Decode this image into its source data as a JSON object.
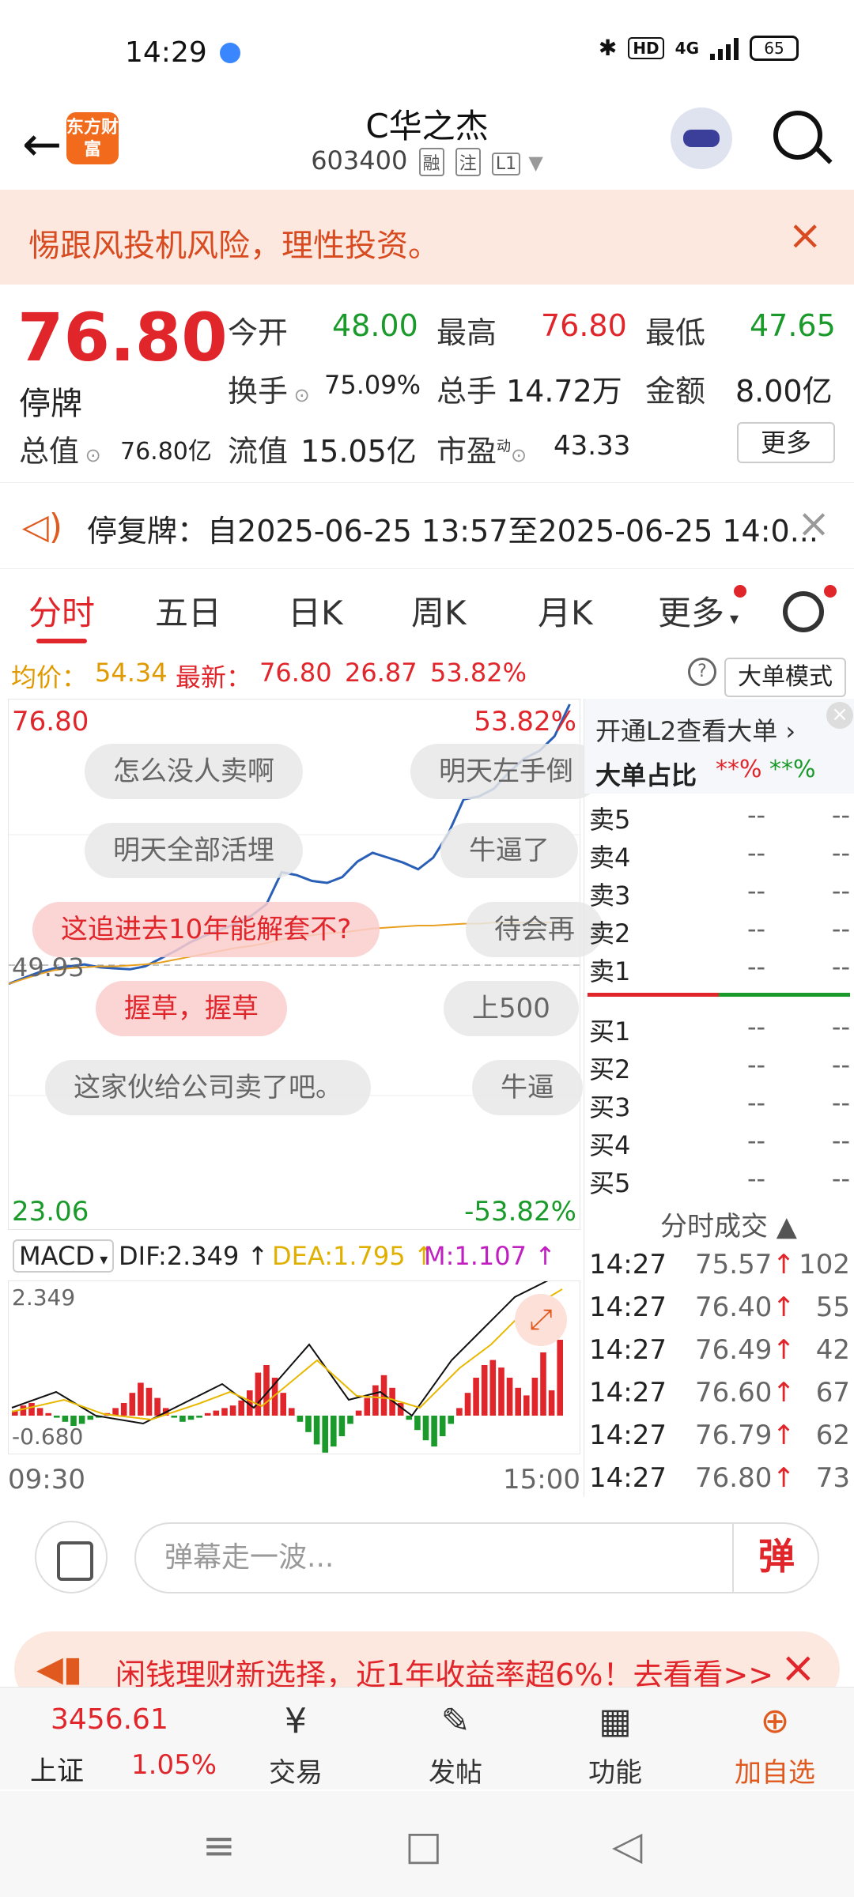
{
  "status_bar": {
    "time": "14:29",
    "network": "4G",
    "battery": "65"
  },
  "header": {
    "back_icon": "←",
    "logo_text": "东方财富",
    "title": "C华之杰",
    "code": "603400",
    "tags": [
      "融",
      "注",
      "L1"
    ]
  },
  "warning": {
    "text": "惕跟风投机风险，理性投资。",
    "close": "×"
  },
  "quote": {
    "price": "76.80",
    "status": "停牌",
    "fields": [
      {
        "label": "今开",
        "value": "48.00",
        "color": "green"
      },
      {
        "label": "最高",
        "value": "76.80",
        "color": "red"
      },
      {
        "label": "最低",
        "value": "47.65",
        "color": "green"
      },
      {
        "label": "换手",
        "value": "75.09%",
        "color": "plain"
      },
      {
        "label": "总手",
        "value": "14.72万",
        "color": "plain"
      },
      {
        "label": "金额",
        "value": "8.00亿",
        "color": "plain"
      },
      {
        "label": "总值",
        "value": "76.80亿",
        "color": "plain"
      },
      {
        "label": "流值",
        "value": "15.05亿",
        "color": "plain"
      },
      {
        "label": "市盈",
        "value": "43.33",
        "color": "plain"
      }
    ],
    "pe_sup": "动",
    "more": "更多"
  },
  "notice": {
    "label": "停复牌：",
    "text": "自2025-06-25 13:57至2025-06-25 14:0..."
  },
  "tabs": [
    "分时",
    "五日",
    "日K",
    "周K",
    "月K",
    "更多"
  ],
  "info_line": {
    "avg_label": "均价：",
    "avg_value": "54.34",
    "latest_label": "最新：",
    "latest_value": "76.80",
    "change": "26.87",
    "pct": "53.82%",
    "mode": "大单模式",
    "help": "?"
  },
  "chart": {
    "y_top": "76.80",
    "y_top_pct": "53.82%",
    "y_mid": "49.93",
    "y_bot": "23.06",
    "y_bot_pct": "-53.82%",
    "time_start": "09:30",
    "time_end": "15:00",
    "danmaku": [
      {
        "text": "怎么没人卖啊",
        "hot": false
      },
      {
        "text": "明天左手倒",
        "hot": false
      },
      {
        "text": "明天全部活埋",
        "hot": false
      },
      {
        "text": "牛逼了",
        "hot": false
      },
      {
        "text": "这追进去10年能解套不?",
        "hot": true
      },
      {
        "text": "待会再",
        "hot": false
      },
      {
        "text": "握草，握草",
        "hot": true
      },
      {
        "text": "上500",
        "hot": false
      },
      {
        "text": "这家伙给公司卖了吧。",
        "hot": false
      },
      {
        "text": "牛逼",
        "hot": false
      }
    ]
  },
  "chart_data": {
    "type": "line",
    "x_range": [
      "09:30",
      "15:00"
    ],
    "ylim": [
      23.06,
      76.8
    ],
    "y_ref": 49.93,
    "series": [
      {
        "values": [
          48.0,
          48.6,
          49.2,
          49.6,
          49.8,
          50.0,
          49.7,
          49.6,
          49.5,
          49.8,
          50.6,
          51.4,
          52.3,
          53.0,
          53.6,
          54.2,
          55.0,
          56.2,
          59.5,
          59.2,
          58.6,
          58.4,
          59.0,
          60.6,
          61.5,
          61.0,
          60.5,
          59.8,
          61.0,
          63.5,
          67.0,
          67.3,
          68.1,
          69.8,
          71.2,
          72.0,
          73.5,
          76.8
        ]
      },
      {
        "values": [
          48.0,
          48.5,
          49.0,
          49.4,
          49.6,
          49.7,
          49.8,
          49.8,
          49.9,
          50.0,
          50.2,
          50.5,
          50.8,
          51.1,
          51.4,
          51.7,
          51.9,
          52.2,
          52.6,
          52.8,
          53.0,
          53.2,
          53.3,
          53.5,
          53.7,
          53.8,
          53.9,
          54.0,
          54.0,
          54.1,
          54.2,
          54.2,
          54.3,
          54.3,
          54.3,
          54.3,
          54.3,
          54.34
        ]
      }
    ]
  },
  "macd": {
    "label": "MACD",
    "dif": "DIF:2.349",
    "dea": "DEA:1.795",
    "m": "M:1.107",
    "top": "2.349",
    "bot": "-0.680"
  },
  "right_panel": {
    "l2": "开通L2查看大单",
    "ratio_label": "大单占比",
    "ratio_red": "**%",
    "ratio_green": "**%",
    "sells": [
      "卖5",
      "卖4",
      "卖3",
      "卖2",
      "卖1"
    ],
    "buys": [
      "买1",
      "买2",
      "买3",
      "买4",
      "买5"
    ],
    "placeholder": "--",
    "trades_title": "分时成交",
    "trades": [
      {
        "time": "14:27",
        "price": "75.57",
        "vol": "102"
      },
      {
        "time": "14:27",
        "price": "76.40",
        "vol": "55"
      },
      {
        "time": "14:27",
        "price": "76.49",
        "vol": "42"
      },
      {
        "time": "14:27",
        "price": "76.60",
        "vol": "67"
      },
      {
        "time": "14:27",
        "price": "76.79",
        "vol": "62"
      },
      {
        "time": "14:27",
        "price": "76.80",
        "vol": "73"
      }
    ]
  },
  "danmaku_input": {
    "placeholder": "弹幕走一波...",
    "send": "弹"
  },
  "ad": {
    "text": "闲钱理财新选择，近1年收益率超6%！去看看>>"
  },
  "bottom_nav": {
    "index_value": "3456.61",
    "index_name": "上证",
    "index_pct": "1.05%",
    "items": [
      "交易",
      "发帖",
      "功能",
      "加自选"
    ]
  }
}
